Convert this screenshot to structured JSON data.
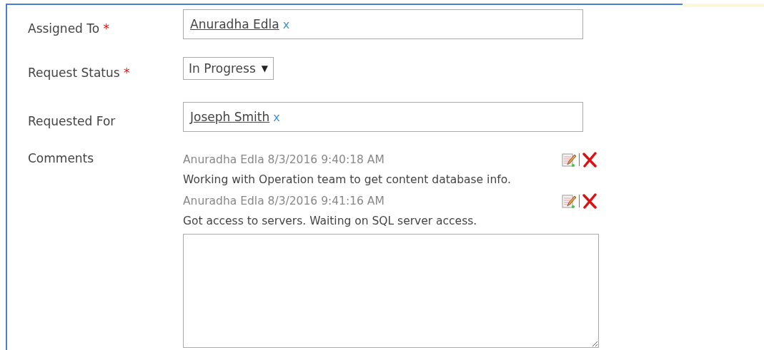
{
  "fields": [
    {
      "kind": "people",
      "label": "Assigned To",
      "required": true,
      "people": [
        "Anuradha Edla"
      ],
      "remove": "x"
    },
    {
      "kind": "select",
      "label": "Request Status",
      "required": true,
      "value": "In Progress",
      "arrow": "▼"
    },
    {
      "kind": "people",
      "label": "Requested For",
      "required": false,
      "people": [
        "Joseph Smith"
      ],
      "remove": "x"
    },
    {
      "kind": "comments",
      "label": "Comments",
      "required": false,
      "entries": [
        {
          "author": "Anuradha Edla",
          "time": "8/3/2016 9:40:18 AM",
          "text": "Working with Operation team to get content database info."
        },
        {
          "author": "Anuradha Edla",
          "time": "8/3/2016 9:41:16 AM",
          "text": "Got access to servers. Waiting on SQL server access."
        }
      ]
    }
  ],
  "required_mark": "*"
}
